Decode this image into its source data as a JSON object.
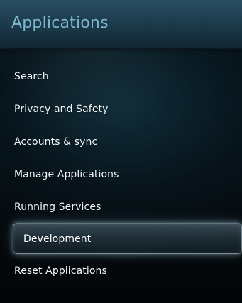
{
  "app": {
    "title": "Applications"
  },
  "menu": {
    "items": [
      {
        "label": "Search",
        "selected": false
      },
      {
        "label": "Privacy and Safety",
        "selected": false
      },
      {
        "label": "Accounts & sync",
        "selected": false
      },
      {
        "label": "Manage Applications",
        "selected": false
      },
      {
        "label": "Running Services",
        "selected": false
      },
      {
        "label": "Development",
        "selected": true
      },
      {
        "label": "Reset Applications",
        "selected": false
      }
    ]
  },
  "colors": {
    "header_text": "#7fb7cf",
    "header_bg": "#1a3949",
    "background": "#050709",
    "item_text": "#f2f6f8",
    "selected_border": "#cde2eb",
    "selected_glow": "#aad2e1"
  }
}
